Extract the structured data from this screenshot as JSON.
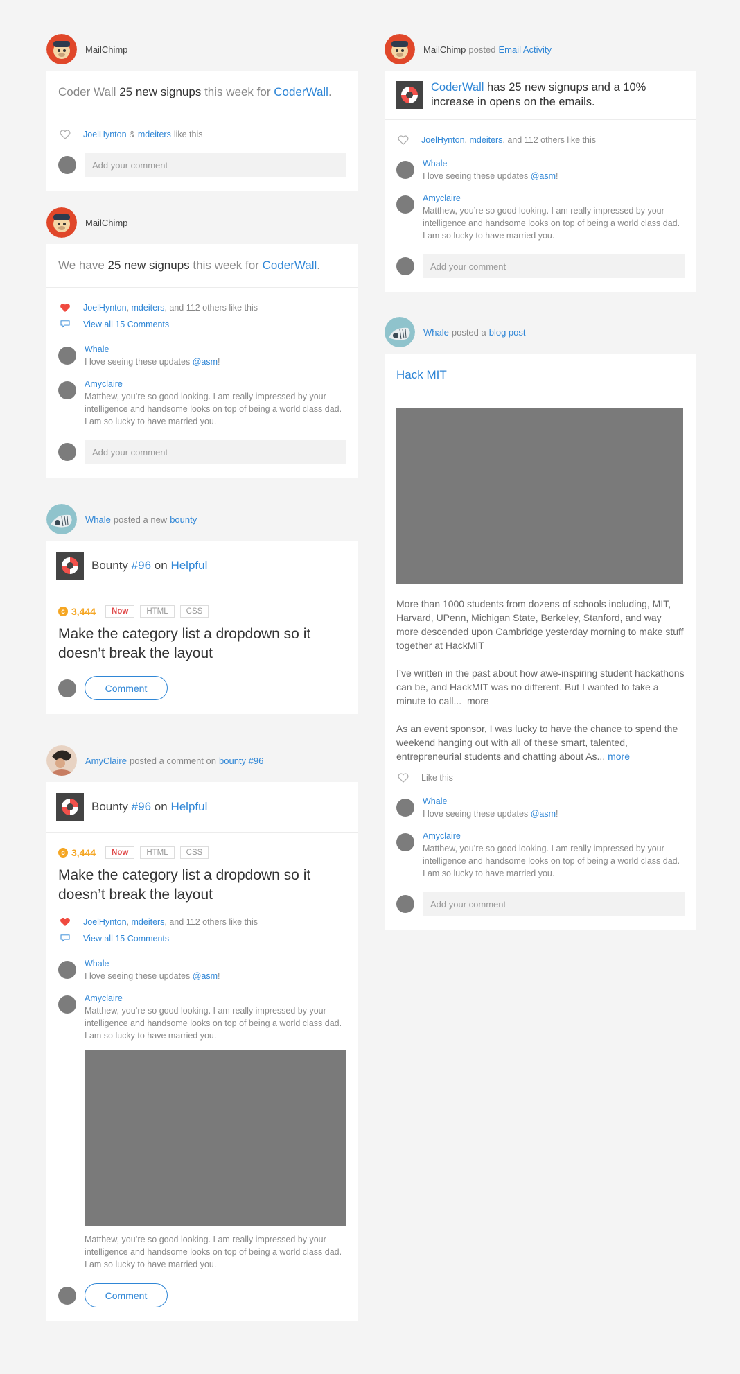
{
  "feed1": {
    "poster": "MailChimp",
    "head_pre": "Coder Wall",
    "head_bold": "25 new signups",
    "head_mid": "this week for",
    "head_link": "CoderWall",
    "head_end": ".",
    "like_user1": "JoelHynton",
    "like_amp": "&",
    "like_user2": "mdeiters",
    "like_suffix": "like this",
    "comment_placeholder": "Add your comment"
  },
  "feed2": {
    "poster": "MailChimp",
    "head_pre": "We have",
    "head_bold": "25 new signups",
    "head_mid": "this week for",
    "head_link": "CoderWall",
    "head_end": ".",
    "like_user1": "JoelHynton",
    "like_user2": "mdeiters",
    "like_suffix": ", and 112 others like this",
    "view_all": "View all 15 Comments",
    "c1_name": "Whale",
    "c1_text": "I love seeing these updates",
    "c1_mention": "@asm",
    "c2_name": "Amyclaire",
    "c2_text": "Matthew, you’re so good looking. I am really impressed by your intelligence and handsome looks on top of being a world class dad. I am so lucky to have married you.",
    "comment_placeholder": "Add your comment"
  },
  "feed3": {
    "poster": "Whale",
    "action": "posted a new",
    "action_link": "bounty",
    "bounty_word": "Bounty",
    "bounty_num": "#96",
    "on_word": "on",
    "bounty_link": "Helpful",
    "amount": "3,444",
    "tag_now": "Now",
    "tag1": "HTML",
    "tag2": "CSS",
    "title": "Make the category list a dropdown so it doesn’t break the layout",
    "button": "Comment"
  },
  "feed4": {
    "poster": "AmyClaire",
    "action": "posted a comment on",
    "action_link": "bounty #96",
    "bounty_word": "Bounty",
    "bounty_num": "#96",
    "on_word": "on",
    "bounty_link": "Helpful",
    "amount": "3,444",
    "tag_now": "Now",
    "tag1": "HTML",
    "tag2": "CSS",
    "title": "Make the category list a dropdown so it doesn’t break the layout",
    "like_user1": "JoelHynton",
    "like_user2": "mdeiters",
    "like_suffix": ", and 112 others like this",
    "view_all": "View all 15 Comments",
    "c1_name": "Whale",
    "c1_text": "I love seeing these updates",
    "c1_mention": "@asm",
    "c2_name": "Amyclaire",
    "c2_text": "Matthew, you’re so good looking. I am really impressed by your intelligence and handsome looks on top of being a world class dad. I am so lucky to have married you.",
    "c3_text": "Matthew, you’re so good looking. I am really impressed by your intelligence and handsome looks on top of being a world class dad. I am so lucky to have married you.",
    "button": "Comment"
  },
  "feed5": {
    "poster": "MailChimp",
    "action": "posted",
    "action_link": "Email Activity",
    "head_link": "CoderWall",
    "head_text": "has 25 new signups and a 10% increase in opens on the emails.",
    "like_user1": "JoelHynton",
    "like_user2": "mdeiters",
    "like_suffix": ", and 112 others like this",
    "c1_name": "Whale",
    "c1_text": "I love seeing these updates",
    "c1_mention": "@asm",
    "c2_name": "Amyclaire",
    "c2_text": "Matthew, you’re so good looking. I am really impressed by your intelligence and handsome looks on top of being a world class dad. I am so lucky to have married you.",
    "comment_placeholder": "Add your comment"
  },
  "feed6": {
    "poster": "Whale",
    "action": "posted a",
    "action_link": "blog post",
    "title": "Hack MIT",
    "p1": "More than 1000 students from dozens of schools including, MIT, Harvard, UPenn, Michigan State, Berkeley, Stanford, and way more descended upon Cambridge yesterday morning to make stuff together at HackMIT",
    "p2": "I’ve written in the past about how awe-inspiring student hackathons can be, and HackMIT was no different. But I wanted to take a minute to call...",
    "p2_more": "more",
    "p3": "As an event sponsor, I was lucky to have the chance to spend the weekend hanging out with all of these smart, talented, entrepreneurial students and chatting about As...",
    "p3_more": "more",
    "like_label": "Like this",
    "c1_name": "Whale",
    "c1_text": "I love seeing these updates",
    "c1_mention": "@asm",
    "c2_name": "Amyclaire",
    "c2_text": "Matthew, you’re so good looking. I am really impressed by your intelligence and handsome looks on top of being a world class dad. I am so lucky to have married you.",
    "comment_placeholder": "Add your comment"
  },
  "colors": {
    "link": "#2f86d6",
    "heart": "#f04a3f",
    "coin": "#f5a623",
    "now": "#e04a4a",
    "background": "#f4f4f4",
    "placeholder_image": "#7a7a7a"
  }
}
